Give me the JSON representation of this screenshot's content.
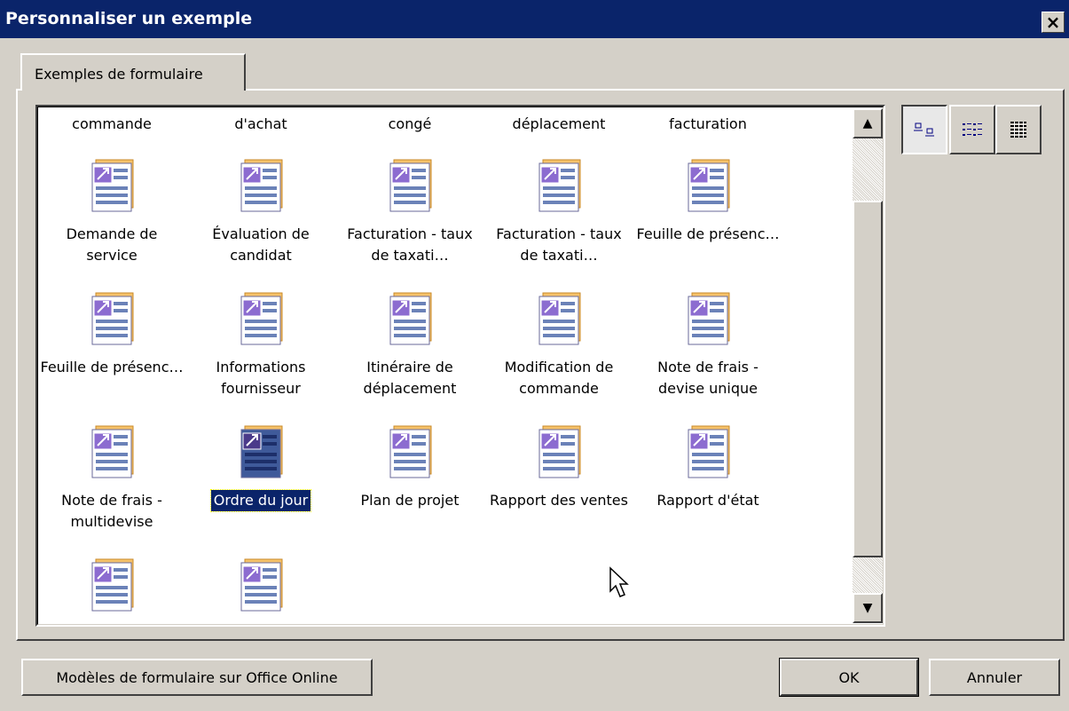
{
  "window": {
    "title": "Personnaliser un exemple",
    "close_label": "×"
  },
  "tab": {
    "label": "Exemples de formulaire"
  },
  "list": {
    "row0": [
      "commande",
      "d'achat",
      "congé",
      "déplacement",
      "facturation"
    ],
    "row1": [
      "Demande de service",
      "Évaluation de candidat",
      "Facturation - taux de taxati…",
      "Facturation - taux de taxati…",
      "Feuille de présenc…"
    ],
    "row2": [
      "Feuille de présenc…",
      "Informations fournisseur",
      "Itinéraire de déplacement",
      "Modification de commande",
      "Note de frais - devise unique"
    ],
    "row3": [
      "Note de frais - multidevise",
      "Ordre du jour",
      "Plan de projet",
      "Rapport des ventes",
      "Rapport d'état"
    ],
    "selected": "Ordre du jour",
    "icon": "form-template-icon"
  },
  "scrollbar": {
    "up": "▲",
    "down": "▼"
  },
  "view_buttons": [
    "large-icons-view-icon",
    "small-icons-view-icon",
    "details-view-icon"
  ],
  "buttons": {
    "online": "Modèles de formulaire sur Office Online",
    "ok": "OK",
    "cancel": "Annuler"
  }
}
